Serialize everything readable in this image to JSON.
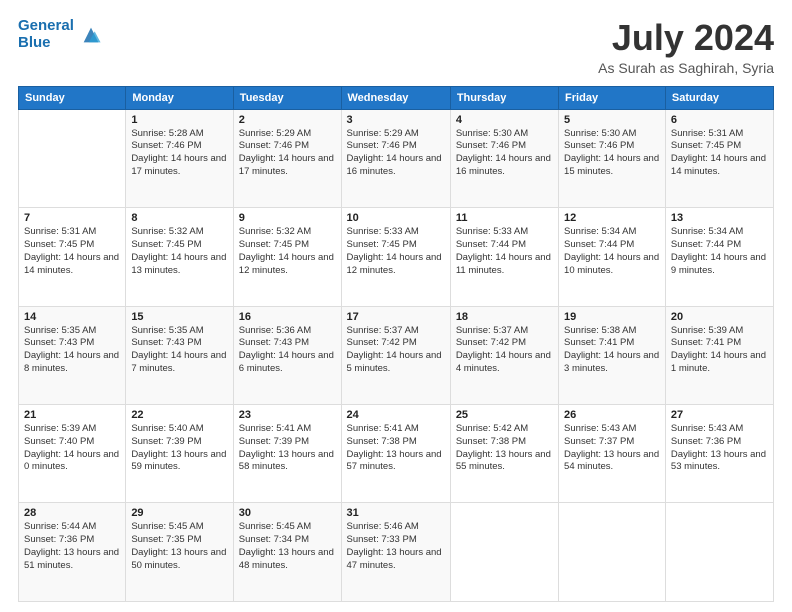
{
  "header": {
    "logo_line1": "General",
    "logo_line2": "Blue",
    "month_year": "July 2024",
    "location": "As Surah as Saghirah, Syria"
  },
  "weekdays": [
    "Sunday",
    "Monday",
    "Tuesday",
    "Wednesday",
    "Thursday",
    "Friday",
    "Saturday"
  ],
  "weeks": [
    [
      {
        "day": "",
        "sunrise": "",
        "sunset": "",
        "daylight": ""
      },
      {
        "day": "1",
        "sunrise": "Sunrise: 5:28 AM",
        "sunset": "Sunset: 7:46 PM",
        "daylight": "Daylight: 14 hours and 17 minutes."
      },
      {
        "day": "2",
        "sunrise": "Sunrise: 5:29 AM",
        "sunset": "Sunset: 7:46 PM",
        "daylight": "Daylight: 14 hours and 17 minutes."
      },
      {
        "day": "3",
        "sunrise": "Sunrise: 5:29 AM",
        "sunset": "Sunset: 7:46 PM",
        "daylight": "Daylight: 14 hours and 16 minutes."
      },
      {
        "day": "4",
        "sunrise": "Sunrise: 5:30 AM",
        "sunset": "Sunset: 7:46 PM",
        "daylight": "Daylight: 14 hours and 16 minutes."
      },
      {
        "day": "5",
        "sunrise": "Sunrise: 5:30 AM",
        "sunset": "Sunset: 7:46 PM",
        "daylight": "Daylight: 14 hours and 15 minutes."
      },
      {
        "day": "6",
        "sunrise": "Sunrise: 5:31 AM",
        "sunset": "Sunset: 7:45 PM",
        "daylight": "Daylight: 14 hours and 14 minutes."
      }
    ],
    [
      {
        "day": "7",
        "sunrise": "Sunrise: 5:31 AM",
        "sunset": "Sunset: 7:45 PM",
        "daylight": "Daylight: 14 hours and 14 minutes."
      },
      {
        "day": "8",
        "sunrise": "Sunrise: 5:32 AM",
        "sunset": "Sunset: 7:45 PM",
        "daylight": "Daylight: 14 hours and 13 minutes."
      },
      {
        "day": "9",
        "sunrise": "Sunrise: 5:32 AM",
        "sunset": "Sunset: 7:45 PM",
        "daylight": "Daylight: 14 hours and 12 minutes."
      },
      {
        "day": "10",
        "sunrise": "Sunrise: 5:33 AM",
        "sunset": "Sunset: 7:45 PM",
        "daylight": "Daylight: 14 hours and 12 minutes."
      },
      {
        "day": "11",
        "sunrise": "Sunrise: 5:33 AM",
        "sunset": "Sunset: 7:44 PM",
        "daylight": "Daylight: 14 hours and 11 minutes."
      },
      {
        "day": "12",
        "sunrise": "Sunrise: 5:34 AM",
        "sunset": "Sunset: 7:44 PM",
        "daylight": "Daylight: 14 hours and 10 minutes."
      },
      {
        "day": "13",
        "sunrise": "Sunrise: 5:34 AM",
        "sunset": "Sunset: 7:44 PM",
        "daylight": "Daylight: 14 hours and 9 minutes."
      }
    ],
    [
      {
        "day": "14",
        "sunrise": "Sunrise: 5:35 AM",
        "sunset": "Sunset: 7:43 PM",
        "daylight": "Daylight: 14 hours and 8 minutes."
      },
      {
        "day": "15",
        "sunrise": "Sunrise: 5:35 AM",
        "sunset": "Sunset: 7:43 PM",
        "daylight": "Daylight: 14 hours and 7 minutes."
      },
      {
        "day": "16",
        "sunrise": "Sunrise: 5:36 AM",
        "sunset": "Sunset: 7:43 PM",
        "daylight": "Daylight: 14 hours and 6 minutes."
      },
      {
        "day": "17",
        "sunrise": "Sunrise: 5:37 AM",
        "sunset": "Sunset: 7:42 PM",
        "daylight": "Daylight: 14 hours and 5 minutes."
      },
      {
        "day": "18",
        "sunrise": "Sunrise: 5:37 AM",
        "sunset": "Sunset: 7:42 PM",
        "daylight": "Daylight: 14 hours and 4 minutes."
      },
      {
        "day": "19",
        "sunrise": "Sunrise: 5:38 AM",
        "sunset": "Sunset: 7:41 PM",
        "daylight": "Daylight: 14 hours and 3 minutes."
      },
      {
        "day": "20",
        "sunrise": "Sunrise: 5:39 AM",
        "sunset": "Sunset: 7:41 PM",
        "daylight": "Daylight: 14 hours and 1 minute."
      }
    ],
    [
      {
        "day": "21",
        "sunrise": "Sunrise: 5:39 AM",
        "sunset": "Sunset: 7:40 PM",
        "daylight": "Daylight: 14 hours and 0 minutes."
      },
      {
        "day": "22",
        "sunrise": "Sunrise: 5:40 AM",
        "sunset": "Sunset: 7:39 PM",
        "daylight": "Daylight: 13 hours and 59 minutes."
      },
      {
        "day": "23",
        "sunrise": "Sunrise: 5:41 AM",
        "sunset": "Sunset: 7:39 PM",
        "daylight": "Daylight: 13 hours and 58 minutes."
      },
      {
        "day": "24",
        "sunrise": "Sunrise: 5:41 AM",
        "sunset": "Sunset: 7:38 PM",
        "daylight": "Daylight: 13 hours and 57 minutes."
      },
      {
        "day": "25",
        "sunrise": "Sunrise: 5:42 AM",
        "sunset": "Sunset: 7:38 PM",
        "daylight": "Daylight: 13 hours and 55 minutes."
      },
      {
        "day": "26",
        "sunrise": "Sunrise: 5:43 AM",
        "sunset": "Sunset: 7:37 PM",
        "daylight": "Daylight: 13 hours and 54 minutes."
      },
      {
        "day": "27",
        "sunrise": "Sunrise: 5:43 AM",
        "sunset": "Sunset: 7:36 PM",
        "daylight": "Daylight: 13 hours and 53 minutes."
      }
    ],
    [
      {
        "day": "28",
        "sunrise": "Sunrise: 5:44 AM",
        "sunset": "Sunset: 7:36 PM",
        "daylight": "Daylight: 13 hours and 51 minutes."
      },
      {
        "day": "29",
        "sunrise": "Sunrise: 5:45 AM",
        "sunset": "Sunset: 7:35 PM",
        "daylight": "Daylight: 13 hours and 50 minutes."
      },
      {
        "day": "30",
        "sunrise": "Sunrise: 5:45 AM",
        "sunset": "Sunset: 7:34 PM",
        "daylight": "Daylight: 13 hours and 48 minutes."
      },
      {
        "day": "31",
        "sunrise": "Sunrise: 5:46 AM",
        "sunset": "Sunset: 7:33 PM",
        "daylight": "Daylight: 13 hours and 47 minutes."
      },
      {
        "day": "",
        "sunrise": "",
        "sunset": "",
        "daylight": ""
      },
      {
        "day": "",
        "sunrise": "",
        "sunset": "",
        "daylight": ""
      },
      {
        "day": "",
        "sunrise": "",
        "sunset": "",
        "daylight": ""
      }
    ]
  ]
}
